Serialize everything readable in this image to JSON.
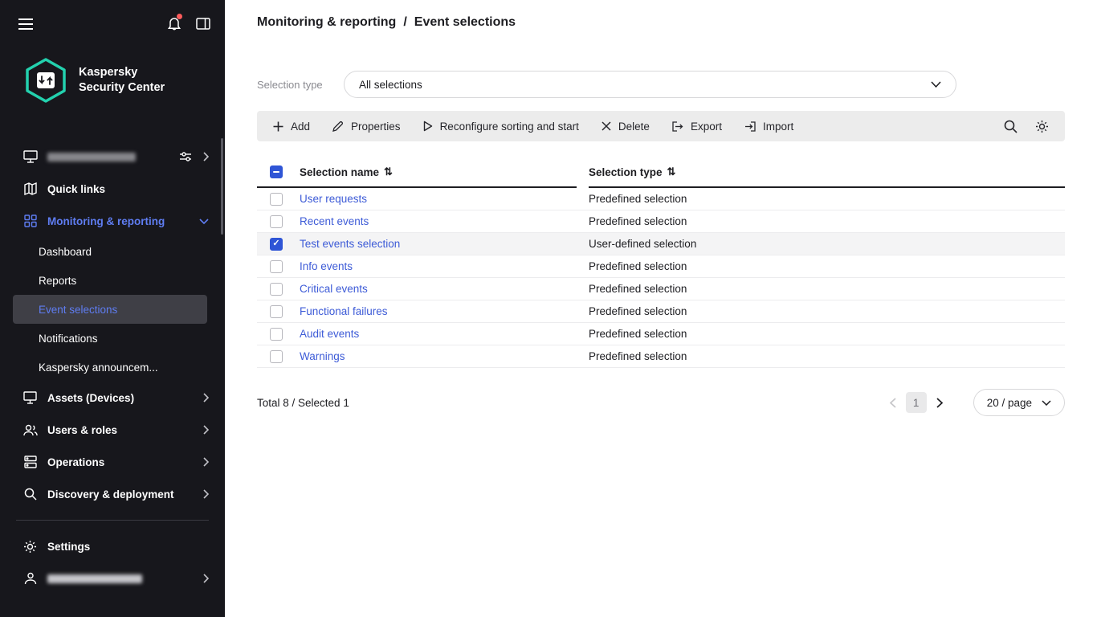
{
  "colors": {
    "accent_blue": "#2f55d6",
    "link_blue": "#3d5bd7",
    "sidebar_highlight_blue": "#5f7df2",
    "brand_teal": "#23d1ae",
    "sidebar_bg": "#17171c",
    "toolbar_bg": "#ececec"
  },
  "brand": {
    "line1": "Kaspersky",
    "line2": "Security Center"
  },
  "sidebar": {
    "items": [
      {
        "label": "",
        "redacted": true
      },
      {
        "label": "Quick links"
      },
      {
        "label": "Monitoring & reporting",
        "expanded": true,
        "highlighted": true
      },
      {
        "label": "Dashboard",
        "sub": true
      },
      {
        "label": "Reports",
        "sub": true
      },
      {
        "label": "Event selections",
        "sub": true,
        "active": true
      },
      {
        "label": "Notifications",
        "sub": true
      },
      {
        "label": "Kaspersky announcem...",
        "sub": true
      },
      {
        "label": "Assets (Devices)"
      },
      {
        "label": "Users & roles"
      },
      {
        "label": "Operations"
      },
      {
        "label": "Discovery & deployment"
      },
      {
        "label": "Settings"
      },
      {
        "label": "",
        "redacted": true
      }
    ]
  },
  "breadcrumb": {
    "parent": "Monitoring & reporting",
    "separator": "/",
    "current": "Event selections"
  },
  "filter": {
    "label": "Selection type",
    "value": "All selections"
  },
  "toolbar": {
    "buttons": [
      {
        "icon": "plus-icon",
        "label": "Add"
      },
      {
        "icon": "pencil-icon",
        "label": "Properties"
      },
      {
        "icon": "play-icon",
        "label": "Reconfigure sorting and start"
      },
      {
        "icon": "close-icon",
        "label": "Delete"
      },
      {
        "icon": "export-icon",
        "label": "Export"
      },
      {
        "icon": "import-icon",
        "label": "Import"
      }
    ],
    "right_icons": [
      "search-icon",
      "gear-icon"
    ]
  },
  "table": {
    "select_all_state": "indeterminate",
    "sort_glyph": "⇅",
    "columns": [
      {
        "label": "Selection name",
        "sortable": true
      },
      {
        "label": "Selection type",
        "sortable": true
      }
    ],
    "rows": [
      {
        "name": "User requests",
        "type": "Predefined selection",
        "checked": false
      },
      {
        "name": "Recent events",
        "type": "Predefined selection",
        "checked": false
      },
      {
        "name": "Test events selection",
        "type": "User-defined selection",
        "checked": true
      },
      {
        "name": "Info events",
        "type": "Predefined selection",
        "checked": false
      },
      {
        "name": "Critical events",
        "type": "Predefined selection",
        "checked": false
      },
      {
        "name": "Functional failures",
        "type": "Predefined selection",
        "checked": false
      },
      {
        "name": "Audit events",
        "type": "Predefined selection",
        "checked": false
      },
      {
        "name": "Warnings",
        "type": "Predefined selection",
        "checked": false
      }
    ]
  },
  "footer": {
    "summary": "Total 8 / Selected 1",
    "current_page": "1",
    "page_size": "20 / page"
  }
}
